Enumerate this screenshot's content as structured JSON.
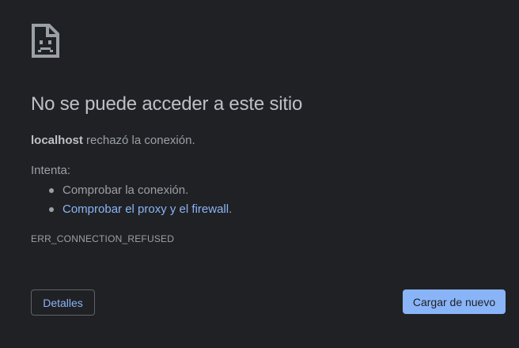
{
  "colors": {
    "background": "#202124",
    "title": "#bdc1c6",
    "text": "#9aa0a6",
    "link": "#8ab4f8",
    "primary_button_bg": "#8ab4f8",
    "secondary_button_border": "#5f6368"
  },
  "icon": "sad-page-icon",
  "title": "No se puede acceder a este sitio",
  "summary": {
    "host": "localhost",
    "message": " rechazó la conexión."
  },
  "try_label": "Intenta:",
  "suggestions": [
    {
      "text": "Comprobar la conexión.",
      "is_link": false
    },
    {
      "link_text": "Comprobar el proxy y el firewall",
      "suffix": ".",
      "is_link": true
    }
  ],
  "error_code": "ERR_CONNECTION_REFUSED",
  "buttons": {
    "details": "Detalles",
    "reload": "Cargar de nuevo"
  }
}
